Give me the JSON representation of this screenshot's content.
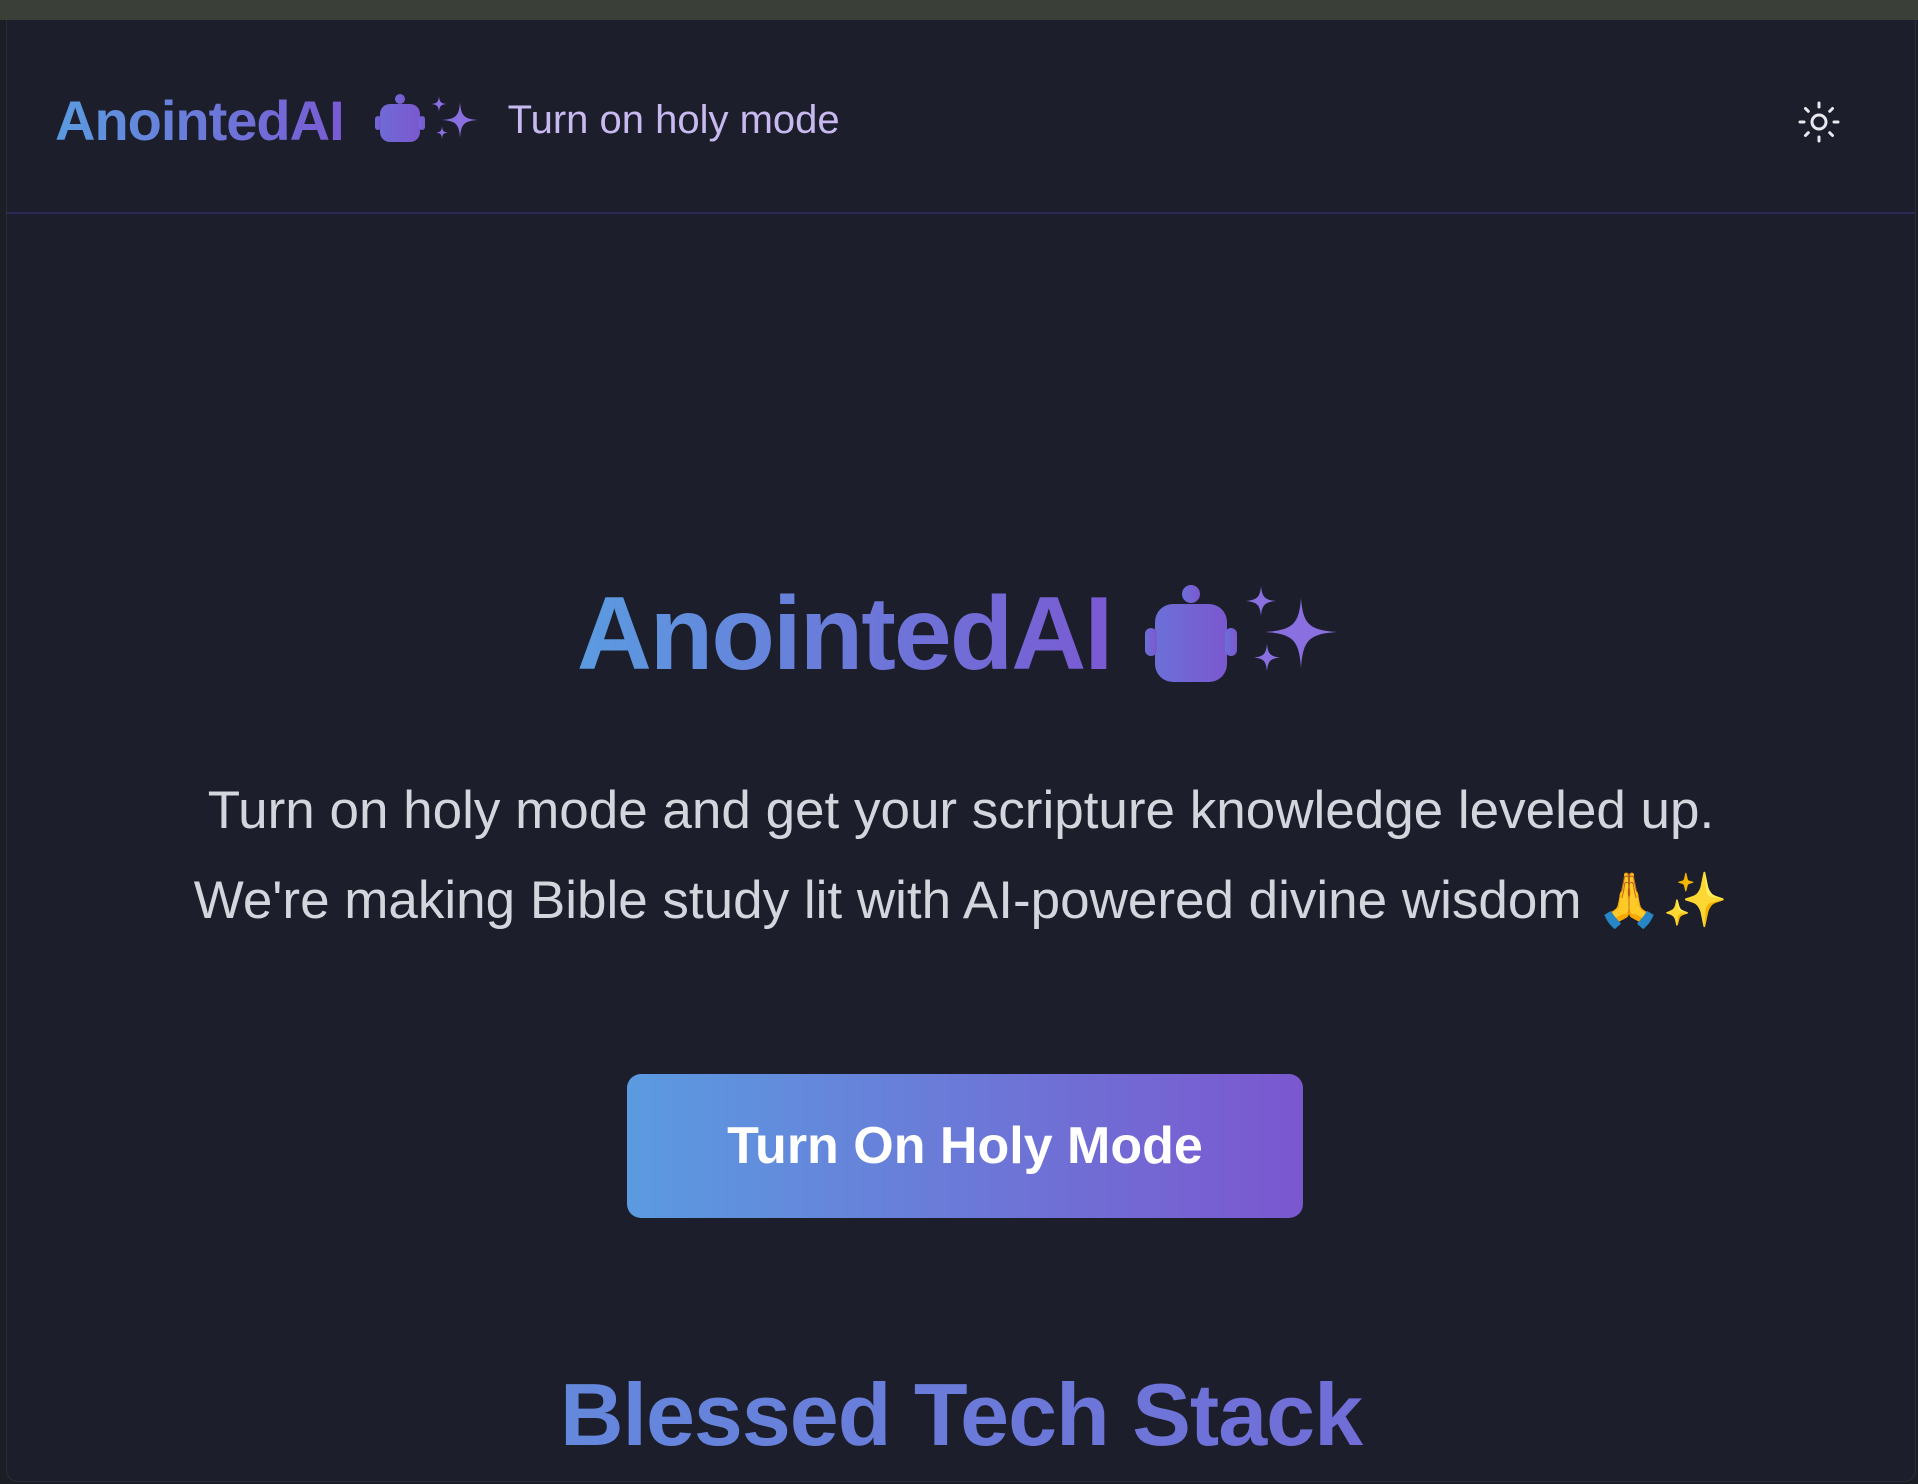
{
  "navbar": {
    "logo_text": "AnointedAI",
    "tagline": "Turn on holy mode",
    "theme_toggle_icon": "sun-icon"
  },
  "hero": {
    "title": "AnointedAI",
    "description_line1": "Turn on holy mode and get your scripture knowledge leveled up.",
    "description_line2": "We're making Bible study lit with AI-powered divine wisdom 🙏✨",
    "cta_label": "Turn On Holy Mode"
  },
  "section": {
    "title": "Blessed Tech Stack"
  },
  "colors": {
    "gradient_start": "#5b9be0",
    "gradient_end": "#7a5ad3",
    "background": "#1c1f2b",
    "tagline": "#c8b9f0",
    "body_text": "#d4d6de"
  }
}
